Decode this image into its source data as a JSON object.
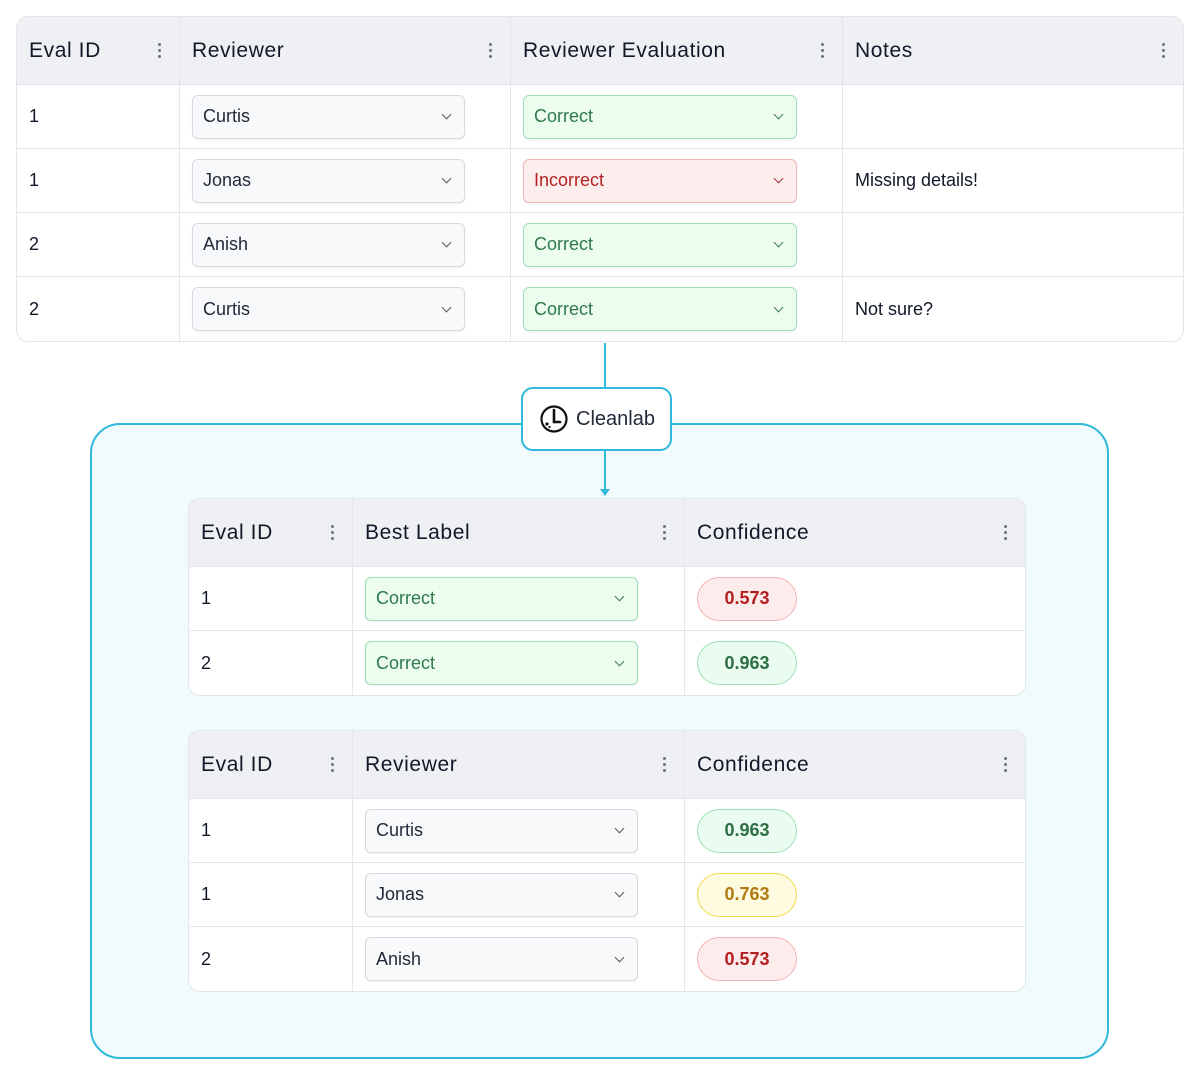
{
  "reviews_table": {
    "columns": [
      "Eval ID",
      "Reviewer",
      "Reviewer Evaluation",
      "Notes"
    ],
    "rows": [
      {
        "eval_id": "1",
        "reviewer": "Curtis",
        "evaluation": "Correct",
        "notes": ""
      },
      {
        "eval_id": "1",
        "reviewer": "Jonas",
        "evaluation": "Incorrect",
        "notes": "Missing details!"
      },
      {
        "eval_id": "2",
        "reviewer": "Anish",
        "evaluation": "Correct",
        "notes": ""
      },
      {
        "eval_id": "2",
        "reviewer": "Curtis",
        "evaluation": "Correct",
        "notes": "Not sure?"
      }
    ]
  },
  "cleanlab": {
    "label": "Cleanlab",
    "accent_color": "#2fb9da"
  },
  "best_label_table": {
    "columns": [
      "Eval ID",
      "Best Label",
      "Confidence"
    ],
    "rows": [
      {
        "eval_id": "1",
        "best_label": "Correct",
        "confidence": "0.573",
        "confidence_level": "low"
      },
      {
        "eval_id": "2",
        "best_label": "Correct",
        "confidence": "0.963",
        "confidence_level": "high"
      }
    ]
  },
  "reviewer_table": {
    "columns": [
      "Eval ID",
      "Reviewer",
      "Confidence"
    ],
    "rows": [
      {
        "eval_id": "1",
        "reviewer": "Curtis",
        "confidence": "0.963",
        "confidence_level": "high"
      },
      {
        "eval_id": "1",
        "reviewer": "Jonas",
        "confidence": "0.763",
        "confidence_level": "medium"
      },
      {
        "eval_id": "2",
        "reviewer": "Anish",
        "confidence": "0.573",
        "confidence_level": "low"
      }
    ]
  },
  "colors": {
    "correct": "#2f7a4b",
    "incorrect": "#b32222",
    "confidence_high": "#2d6e45",
    "confidence_medium": "#b07a10",
    "confidence_low": "#b31f1f"
  }
}
